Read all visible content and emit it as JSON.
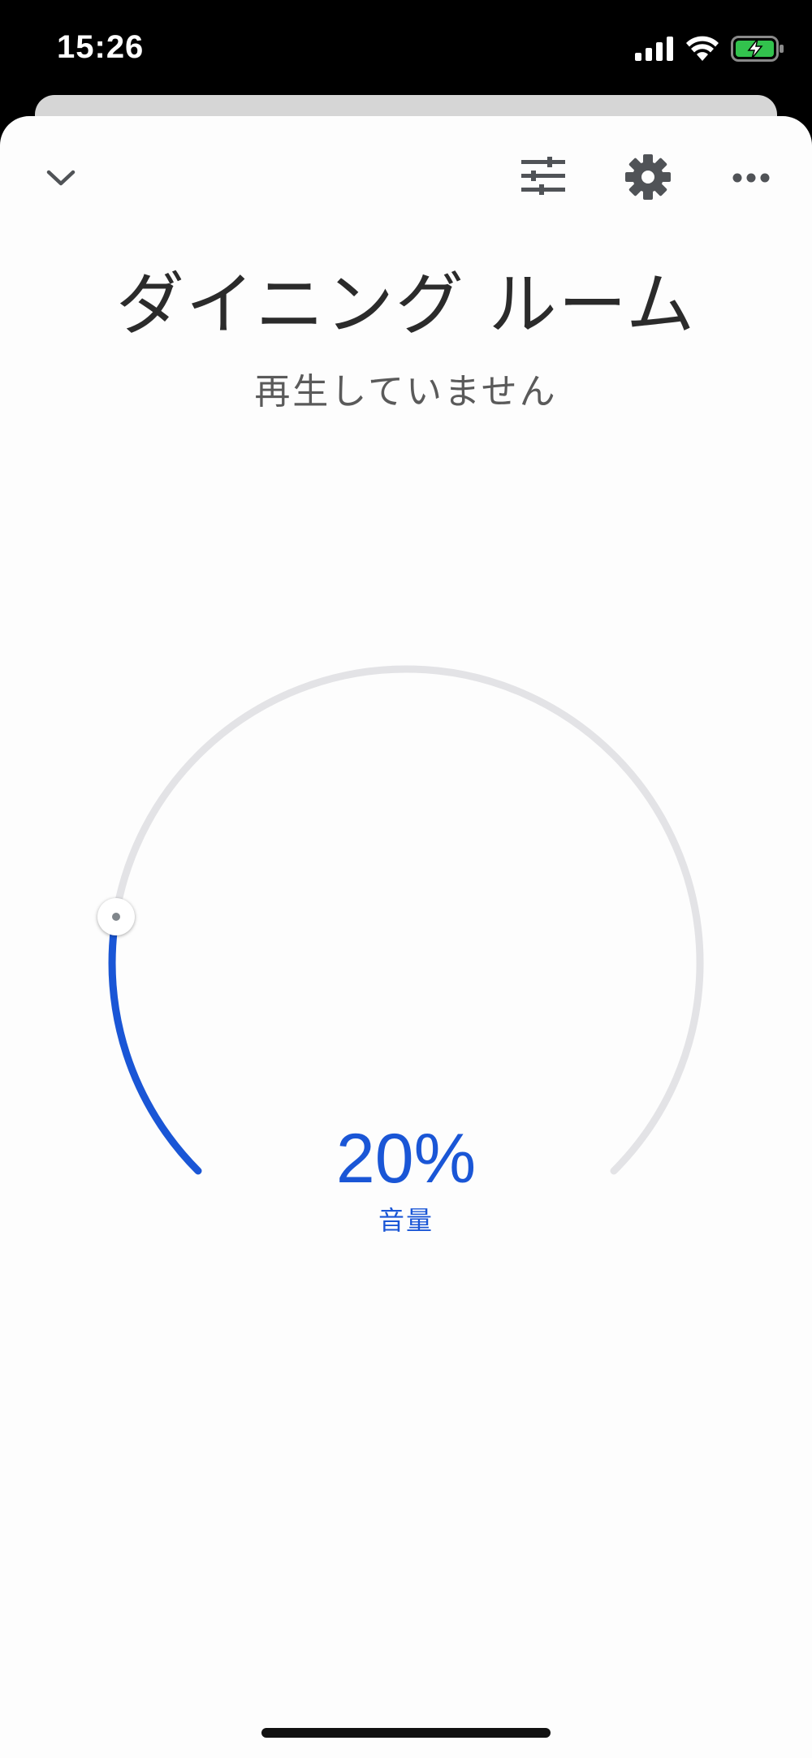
{
  "status_bar": {
    "time": "15:26",
    "icons": [
      "signal-icon",
      "wifi-icon",
      "battery-charging-icon"
    ],
    "battery_color": "#32c24d"
  },
  "header": {
    "icons": [
      "chevron-down-icon",
      "equalizer-icon",
      "gear-icon",
      "more-horiz-icon"
    ]
  },
  "device": {
    "name": "ダイニング ルーム",
    "status": "再生していません"
  },
  "volume": {
    "value_text": "20%",
    "label": "音量",
    "level": 0.2,
    "accent_color": "#1a56d6",
    "track_color": "#e3e3e6"
  }
}
